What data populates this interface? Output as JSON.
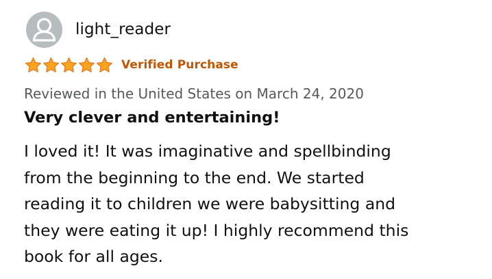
{
  "review": {
    "author": {
      "name": "light_reader",
      "avatar_icon": "default-user-avatar-icon",
      "avatar_color": "#b7bcbf"
    },
    "rating": {
      "stars": 5,
      "max_stars": 5,
      "star_icon": "star-icon",
      "star_color": "#ffa41c"
    },
    "badge": "Verified Purchase",
    "badge_color": "#c45500",
    "meta": "Reviewed in the United States on March 24, 2020",
    "title": "Very clever and entertaining!",
    "body_lines": [
      "I loved it! It was imaginative and spellbinding",
      "from the beginning to the end. We started",
      "reading it to children we were babysitting and",
      "they were eating it up! I highly recommend this",
      "book for all ages."
    ]
  }
}
